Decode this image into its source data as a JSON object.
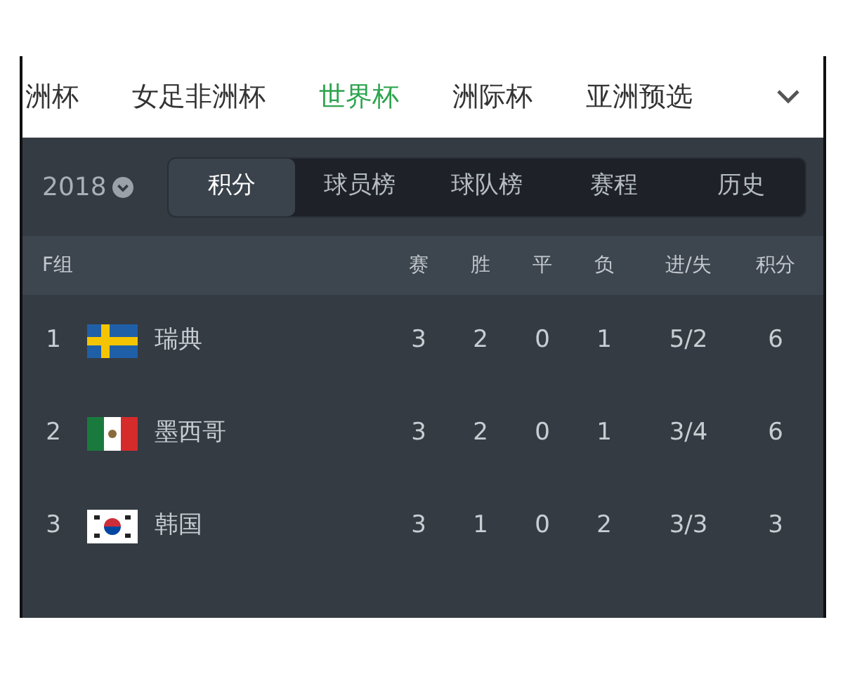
{
  "tabs": [
    {
      "label": "洲杯",
      "selected": false
    },
    {
      "label": "女足非洲杯",
      "selected": false
    },
    {
      "label": "世界杯",
      "selected": true
    },
    {
      "label": "洲际杯",
      "selected": false
    },
    {
      "label": "亚洲预选",
      "selected": false
    }
  ],
  "season": "2018",
  "segments": [
    {
      "label": "积分",
      "selected": true
    },
    {
      "label": "球员榜",
      "selected": false
    },
    {
      "label": "球队榜",
      "selected": false
    },
    {
      "label": "赛程",
      "selected": false
    },
    {
      "label": "历史",
      "selected": false
    }
  ],
  "table": {
    "columns": [
      "F组",
      "赛",
      "胜",
      "平",
      "负",
      "进/失",
      "积分"
    ],
    "rows": [
      {
        "rank": "1",
        "flag": {
          "kind": "sweden"
        },
        "team": "瑞典",
        "played": "3",
        "won": "2",
        "drawn": "0",
        "lost": "1",
        "goals": "5/2",
        "points": "6"
      },
      {
        "rank": "2",
        "flag": {
          "kind": "mexico"
        },
        "team": "墨西哥",
        "played": "3",
        "won": "2",
        "drawn": "0",
        "lost": "1",
        "goals": "3/4",
        "points": "6"
      },
      {
        "rank": "3",
        "flag": {
          "kind": "korea"
        },
        "team": "韩国",
        "played": "3",
        "won": "1",
        "drawn": "0",
        "lost": "2",
        "goals": "3/3",
        "points": "3"
      }
    ]
  }
}
